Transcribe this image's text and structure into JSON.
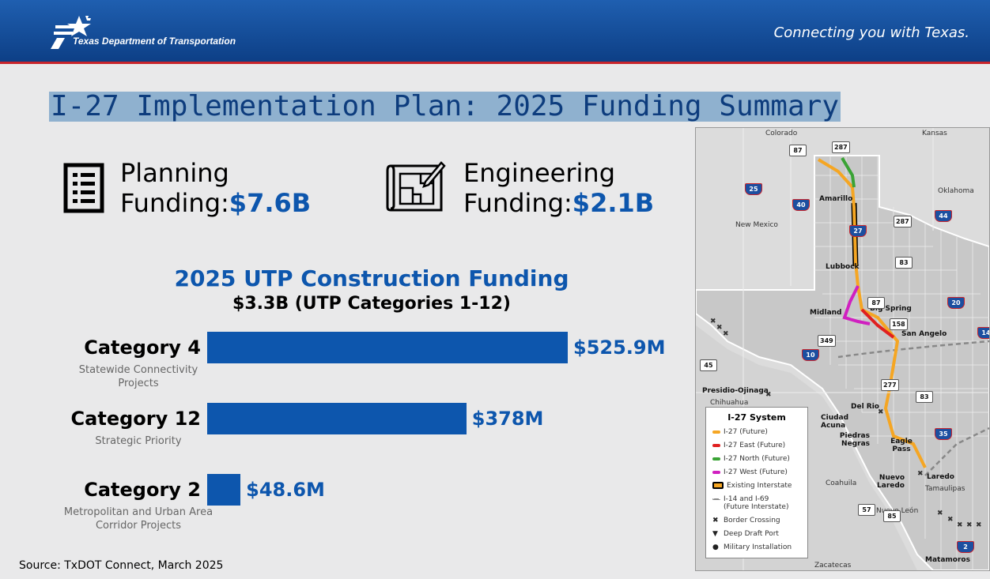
{
  "header": {
    "agency_name": "Texas Department of Transportation",
    "tagline": "Connecting you with Texas."
  },
  "page_title": "I-27 Implementation Plan: 2025 Funding Summary",
  "metrics": [
    {
      "label_line1": "Planning",
      "label_line2": "Funding:",
      "value": "$7.6B",
      "icon": "checklist-icon"
    },
    {
      "label_line1": "Engineering",
      "label_line2": "Funding:",
      "value": "$2.1B",
      "icon": "blueprint-icon"
    }
  ],
  "construction": {
    "title": "2025 UTP Construction Funding",
    "subtitle": "$3.3B (UTP Categories 1-12)"
  },
  "chart_data": {
    "type": "bar",
    "orientation": "horizontal",
    "categories": [
      "Category 4",
      "Category 12",
      "Category 2"
    ],
    "descriptions": [
      "Statewide Connectivity Projects",
      "Strategic Priority",
      "Metropolitan and Urban Area Corridor Projects"
    ],
    "values": [
      525.9,
      378,
      48.6
    ],
    "value_labels": [
      "$525.9M",
      "$378M",
      "$48.6M"
    ],
    "unit": "$M",
    "bar_color": "#0d56ad"
  },
  "source": "Source: TxDOT Connect, March 2025",
  "map": {
    "states": [
      "Colorado",
      "Kansas",
      "Oklahoma",
      "New Mexico",
      "Chihuahua",
      "Coahuila",
      "Nuevo León",
      "Tamaulipas"
    ],
    "cities": [
      "Amarillo",
      "Lubbock",
      "Midland",
      "Big Spring",
      "San Angelo",
      "Presidio-Ojinaga",
      "Del Rio",
      "Ciudad Acuna",
      "Eagle Pass",
      "Piedras Negras",
      "Nuevo Laredo",
      "Laredo",
      "Matamoros",
      "Zacatecas"
    ],
    "highways": [
      "87",
      "287",
      "25",
      "40",
      "27",
      "44",
      "83",
      "20",
      "158",
      "349",
      "10",
      "45",
      "277",
      "14",
      "35",
      "57",
      "85",
      "2"
    ],
    "legend_title": "I-27 System",
    "legend": [
      {
        "label": "I-27 (Future)",
        "color": "#f5a623"
      },
      {
        "label": "I-27 East (Future)",
        "color": "#e02020"
      },
      {
        "label": "I-27 North (Future)",
        "color": "#3aa335"
      },
      {
        "label": "I-27 West (Future)",
        "color": "#d020c0"
      },
      {
        "label": "Existing Interstate",
        "color": "#000000"
      },
      {
        "label": "I-14 and I-69",
        "label2": "(Future Interstate)",
        "color": "#888888"
      },
      {
        "label": "Border Crossing",
        "symbol": "✖"
      },
      {
        "label": "Deep Draft Port",
        "symbol": "▼"
      },
      {
        "label": "Military Installation",
        "symbol": "●"
      }
    ]
  }
}
